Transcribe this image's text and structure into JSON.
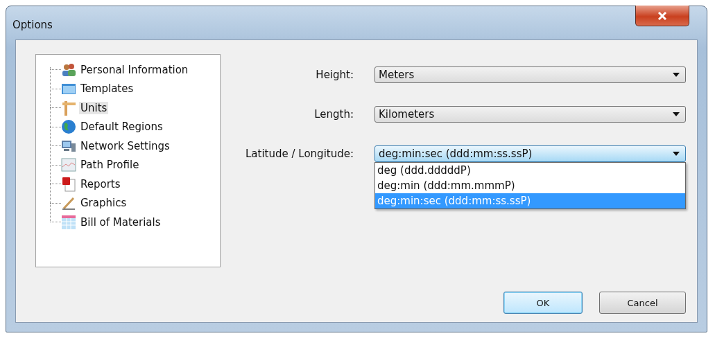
{
  "window": {
    "title": "Options"
  },
  "tree": [
    {
      "label": "Personal Information",
      "selected": false
    },
    {
      "label": "Templates",
      "selected": false
    },
    {
      "label": "Units",
      "selected": true
    },
    {
      "label": "Default Regions",
      "selected": false
    },
    {
      "label": "Network Settings",
      "selected": false
    },
    {
      "label": "Path Profile",
      "selected": false
    },
    {
      "label": "Reports",
      "selected": false
    },
    {
      "label": "Graphics",
      "selected": false
    },
    {
      "label": "Bill of Materials",
      "selected": false
    }
  ],
  "fields": [
    {
      "label": "Height:",
      "value": "Meters",
      "open": false
    },
    {
      "label": "Length:",
      "value": "Kilometers",
      "open": false
    },
    {
      "label": "Latitude / Longitude:",
      "value": "deg:min:sec (ddd:mm:ss.ssP)",
      "open": true,
      "options": [
        {
          "label": "deg (ddd.dddddP)",
          "selected": false
        },
        {
          "label": "deg:min (ddd:mm.mmmP)",
          "selected": false
        },
        {
          "label": "deg:min:sec (ddd:mm:ss.ssP)",
          "selected": true
        }
      ]
    }
  ],
  "buttons": [
    {
      "label": "OK",
      "default": true
    },
    {
      "label": "Cancel",
      "default": false
    }
  ]
}
